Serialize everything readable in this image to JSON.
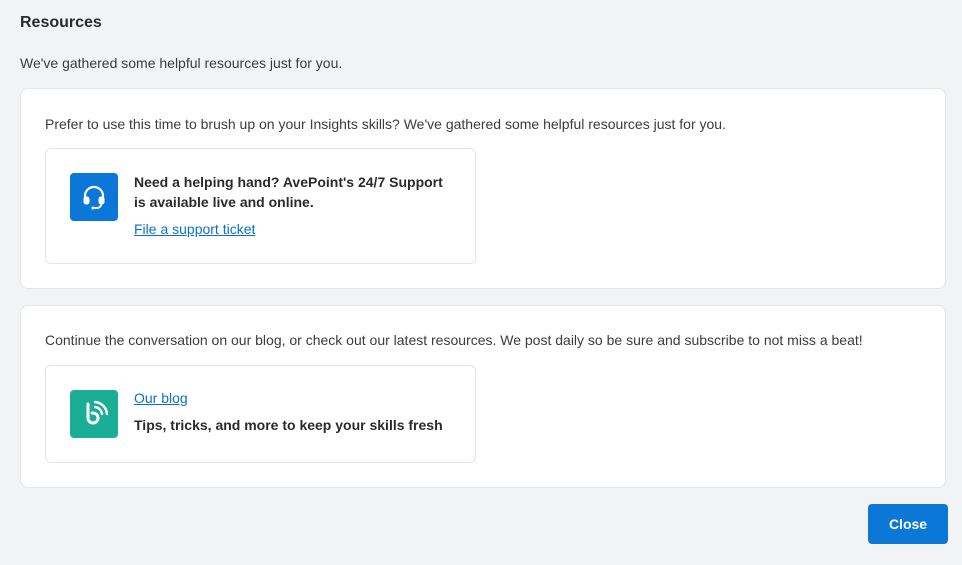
{
  "page": {
    "title": "Resources",
    "subtitle": "We've gathered some helpful resources just for you."
  },
  "support_panel": {
    "intro": "Prefer to use this time to brush up on your Insights skills? We've gathered some helpful resources just for you.",
    "card": {
      "icon": "headset-icon",
      "icon_color": "#0b78d7",
      "heading_line1": "Need a helping hand? AvePoint's 24/7 Support",
      "heading_line2": "is available live and online.",
      "link_label": "File a support ticket"
    }
  },
  "blog_panel": {
    "intro": "Continue the conversation on our blog, or check out our latest resources. We post daily so be sure and subscribe to not miss a beat!",
    "card": {
      "icon": "blog-icon",
      "icon_color": "#1aae96",
      "link_label": "Our blog",
      "description": "Tips, tricks, and more to keep your skills fresh"
    }
  },
  "footer": {
    "close_label": "Close",
    "accent_color": "#0b78d7"
  }
}
